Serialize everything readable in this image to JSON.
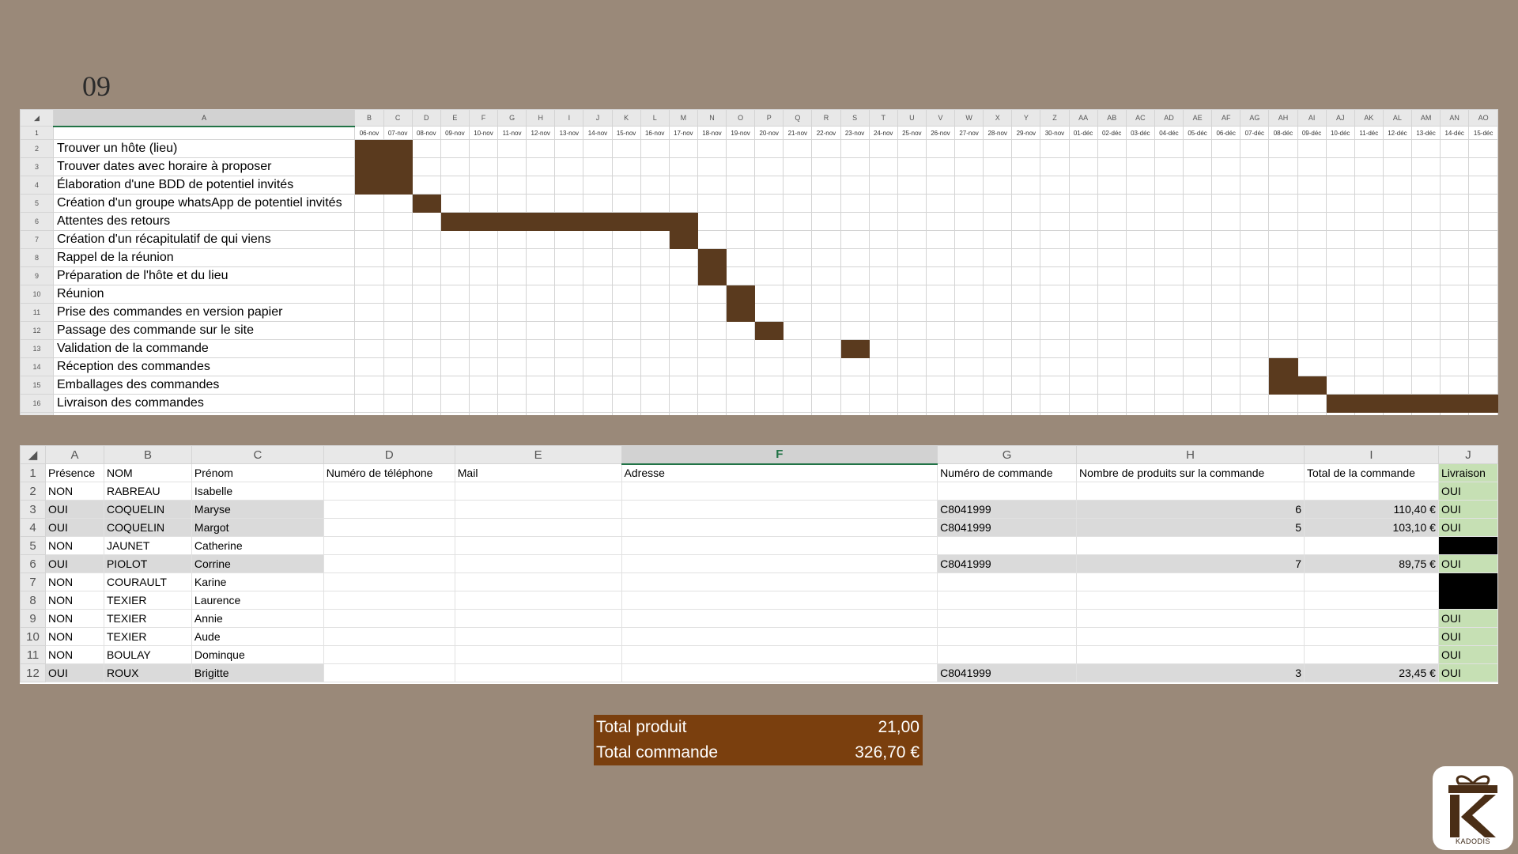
{
  "slide_number": "09",
  "gantt": {
    "corner": "◢",
    "task_col_header": "A",
    "col_letters": [
      "B",
      "C",
      "D",
      "E",
      "F",
      "G",
      "H",
      "I",
      "J",
      "K",
      "L",
      "M",
      "N",
      "O",
      "P",
      "Q",
      "R",
      "S",
      "T",
      "U",
      "V",
      "W",
      "X",
      "Y",
      "Z",
      "AA",
      "AB",
      "AC",
      "AD",
      "AE",
      "AF",
      "AG",
      "AH",
      "AI",
      "AJ",
      "AK",
      "AL",
      "AM",
      "AN",
      "AO"
    ],
    "dates": [
      "06-nov",
      "07-nov",
      "08-nov",
      "09-nov",
      "10-nov",
      "11-nov",
      "12-nov",
      "13-nov",
      "14-nov",
      "15-nov",
      "16-nov",
      "17-nov",
      "18-nov",
      "19-nov",
      "20-nov",
      "21-nov",
      "22-nov",
      "23-nov",
      "24-nov",
      "25-nov",
      "26-nov",
      "27-nov",
      "28-nov",
      "29-nov",
      "30-nov",
      "01-déc",
      "02-déc",
      "03-déc",
      "04-déc",
      "05-déc",
      "06-déc",
      "07-déc",
      "08-déc",
      "09-déc",
      "10-déc",
      "11-déc",
      "12-déc",
      "13-déc",
      "14-déc",
      "15-déc"
    ],
    "date_row_number": "1",
    "tasks": [
      {
        "row": "2",
        "name": "Trouver un hôte (lieu)",
        "start": 0,
        "end": 1
      },
      {
        "row": "3",
        "name": "Trouver dates avec horaire à proposer",
        "start": 0,
        "end": 1
      },
      {
        "row": "4",
        "name": "Élaboration d'une BDD de potentiel invités",
        "start": 0,
        "end": 1
      },
      {
        "row": "5",
        "name": "Création d'un groupe whatsApp de potentiel invités",
        "start": 2,
        "end": 2
      },
      {
        "row": "6",
        "name": "Attentes des retours",
        "start": 3,
        "end": 11
      },
      {
        "row": "7",
        "name": "Création d'un récapitulatif de qui viens",
        "start": 11,
        "end": 11
      },
      {
        "row": "8",
        "name": "Rappel de la réunion",
        "start": 12,
        "end": 12
      },
      {
        "row": "9",
        "name": "Préparation de l'hôte et du lieu",
        "start": 12,
        "end": 12
      },
      {
        "row": "10",
        "name": "Réunion",
        "start": 13,
        "end": 13
      },
      {
        "row": "11",
        "name": "Prise des commandes en version papier",
        "start": 13,
        "end": 13
      },
      {
        "row": "12",
        "name": "Passage des commande sur le site",
        "start": 14,
        "end": 14
      },
      {
        "row": "13",
        "name": "Validation de la commande",
        "start": 17,
        "end": 17
      },
      {
        "row": "14",
        "name": "Réception des commandes",
        "start": 32,
        "end": 32
      },
      {
        "row": "15",
        "name": "Emballages des commandes",
        "start": 32,
        "end": 33
      },
      {
        "row": "16",
        "name": "Livraison des commandes",
        "start": 34,
        "end": 39
      }
    ],
    "bar_color": "#5a3a1e"
  },
  "orders": {
    "corner": "◢",
    "col_letters": [
      "A",
      "B",
      "C",
      "D",
      "E",
      "F",
      "G",
      "H",
      "I",
      "J"
    ],
    "selected_col": "F",
    "header_row_number": "1",
    "headers": [
      "Présence",
      "NOM",
      "Prénom",
      "Numéro de téléphone",
      "Mail",
      "Adresse",
      "Numéro de commande",
      "Nombre de produits sur la commande",
      "Total de la commande",
      "Livraison"
    ],
    "rows": [
      {
        "n": "2",
        "presence": "NON",
        "nom": "RABREAU",
        "prenom": "Isabelle",
        "commande": "",
        "nb": "",
        "total": "",
        "livraison": "OUI",
        "liv_style": "green"
      },
      {
        "n": "3",
        "presence": "OUI",
        "nom": "COQUELIN",
        "prenom": "Maryse",
        "commande": "C8041999",
        "nb": "6",
        "total": "110,40 €",
        "livraison": "OUI",
        "liv_style": "green"
      },
      {
        "n": "4",
        "presence": "OUI",
        "nom": "COQUELIN",
        "prenom": "Margot",
        "commande": "C8041999",
        "nb": "5",
        "total": "103,10 €",
        "livraison": "OUI",
        "liv_style": "green"
      },
      {
        "n": "5",
        "presence": "NON",
        "nom": "JAUNET",
        "prenom": "Catherine",
        "commande": "",
        "nb": "",
        "total": "",
        "livraison": "",
        "liv_style": "black"
      },
      {
        "n": "6",
        "presence": "OUI",
        "nom": "PIOLOT",
        "prenom": "Corrine",
        "commande": "C8041999",
        "nb": "7",
        "total": "89,75 €",
        "livraison": "OUI",
        "liv_style": "green"
      },
      {
        "n": "7",
        "presence": "NON",
        "nom": "COURAULT",
        "prenom": "Karine",
        "commande": "",
        "nb": "",
        "total": "",
        "livraison": "",
        "liv_style": "black-top"
      },
      {
        "n": "8",
        "presence": "NON",
        "nom": "TEXIER",
        "prenom": "Laurence",
        "commande": "",
        "nb": "",
        "total": "",
        "livraison": "",
        "liv_style": "black"
      },
      {
        "n": "9",
        "presence": "NON",
        "nom": "TEXIER",
        "prenom": "Annie",
        "commande": "",
        "nb": "",
        "total": "",
        "livraison": "OUI",
        "liv_style": "green"
      },
      {
        "n": "10",
        "presence": "NON",
        "nom": "TEXIER",
        "prenom": "Aude",
        "commande": "",
        "nb": "",
        "total": "",
        "livraison": "OUI",
        "liv_style": "green"
      },
      {
        "n": "11",
        "presence": "NON",
        "nom": "BOULAY",
        "prenom": "Dominque",
        "commande": "",
        "nb": "",
        "total": "",
        "livraison": "OUI",
        "liv_style": "green"
      },
      {
        "n": "12",
        "presence": "OUI",
        "nom": "ROUX",
        "prenom": "Brigitte",
        "commande": "C8041999",
        "nb": "3",
        "total": "23,45 €",
        "livraison": "OUI",
        "liv_style": "green"
      }
    ]
  },
  "totals": {
    "produit_label": "Total produit",
    "produit_value": "21,00",
    "commande_label": "Total commande",
    "commande_value": "326,70 €"
  },
  "logo": {
    "icon": "gift-k-logo-icon",
    "brand": "KADODIS",
    "color": "#4a2e16"
  }
}
